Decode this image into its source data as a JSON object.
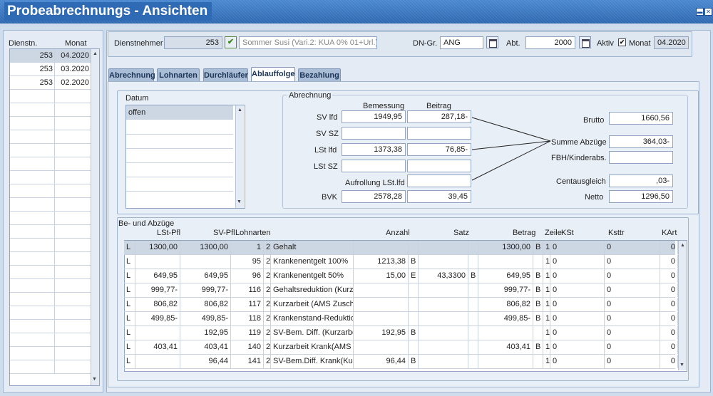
{
  "window": {
    "title": "Probeabrechnungs - Ansichten"
  },
  "left_list": {
    "headers": [
      "Dienstn.",
      "Monat"
    ],
    "rows": [
      {
        "dienstn": "253",
        "monat": "04.2020"
      },
      {
        "dienstn": "253",
        "monat": "03.2020"
      },
      {
        "dienstn": "253",
        "monat": "02.2020"
      }
    ]
  },
  "header": {
    "dienstnehmer_label": "Dienstnehmer",
    "dienstnehmer_nr": "253",
    "dienstnehmer_name": "Sommer Susi (Vari.2: KUA 0% 01+Url.)",
    "dngr_label": "DN-Gr.",
    "dngr_value": "ANG",
    "abt_label": "Abt.",
    "abt_value": "2000",
    "aktiv_label": "Aktiv",
    "aktiv_check": "✔",
    "monat_label": "Monat",
    "monat_value": "04.2020"
  },
  "tabs": [
    "Abrechnung",
    "Lohnarten",
    "Durchläufer",
    "Ablauffolge",
    "Bezahlung"
  ],
  "datum": {
    "label": "Datum",
    "items": [
      "offen"
    ]
  },
  "abrechnung": {
    "group_label": "Abrechnung",
    "col_bemessung": "Bemessung",
    "col_beitrag": "Beitrag",
    "sv_lfd_label": "SV lfd",
    "sv_lfd_bemessung": "1949,95",
    "sv_lfd_beitrag": "287,18-",
    "sv_sz_label": "SV SZ",
    "lst_lfd_label": "LSt lfd",
    "lst_lfd_bemessung": "1373,38",
    "lst_lfd_beitrag": "76,85-",
    "lst_sz_label": "LSt SZ",
    "aufrollung_label": "Aufrollung LSt.lfd",
    "bvk_label": "BVK",
    "bvk_bemessung": "2578,28",
    "bvk_beitrag": "39,45",
    "brutto_label": "Brutto",
    "brutto": "1660,56",
    "summe_label": "Summe Abzüge",
    "summe": "364,03-",
    "fbh_label": "FBH/Kinderabs.",
    "cent_label": "Centausgleich",
    "cent": ",03-",
    "netto_label": "Netto",
    "netto": "1296,50"
  },
  "grid": {
    "group_label": "Be- und Abzüge",
    "headers": {
      "lstpfl": "LSt-Pfl",
      "svpfl": "SV-Pfl",
      "lohnarten": "Lohnarten",
      "anzahl": "Anzahl",
      "satz": "Satz",
      "betrag": "Betrag",
      "zeile": "Zeile",
      "kst": "KSt",
      "ksttr": "Ksttr",
      "kart": "KArt"
    },
    "rows": [
      {
        "t": "L",
        "lst": "1300,00",
        "sv": "1300,00",
        "nr": "1",
        "k": "2",
        "name": "Gehalt",
        "anz": "",
        "af": "",
        "satz": "",
        "sf": "",
        "betrag": "1300,00",
        "bf": "B",
        "zeile": "1",
        "kst": "0",
        "ksttr": "0",
        "kart": "0"
      },
      {
        "t": "L",
        "lst": "",
        "sv": "",
        "nr": "95",
        "k": "2",
        "name": "Krankenentgelt 100%",
        "anz": "1213,38",
        "af": "B",
        "satz": "",
        "sf": "",
        "betrag": "",
        "bf": "",
        "zeile": "1",
        "kst": "0",
        "ksttr": "0",
        "kart": "0"
      },
      {
        "t": "L",
        "lst": "649,95",
        "sv": "649,95",
        "nr": "96",
        "k": "2",
        "name": "Krankenentgelt 50%",
        "anz": "15,00",
        "af": "E",
        "satz": "43,3300",
        "sf": "B",
        "betrag": "649,95",
        "bf": "B",
        "zeile": "1",
        "kst": "0",
        "ksttr": "0",
        "kart": "0"
      },
      {
        "t": "L",
        "lst": "999,77-",
        "sv": "999,77-",
        "nr": "116",
        "k": "2",
        "name": "Gehaltsreduktion (Kurz",
        "anz": "",
        "af": "",
        "satz": "",
        "sf": "",
        "betrag": "999,77-",
        "bf": "B",
        "zeile": "1",
        "kst": "0",
        "ksttr": "0",
        "kart": "0"
      },
      {
        "t": "L",
        "lst": "806,82",
        "sv": "806,82",
        "nr": "117",
        "k": "2",
        "name": "Kurzarbeit (AMS Zusch",
        "anz": "",
        "af": "",
        "satz": "",
        "sf": "",
        "betrag": "806,82",
        "bf": "B",
        "zeile": "1",
        "kst": "0",
        "ksttr": "0",
        "kart": "0"
      },
      {
        "t": "L",
        "lst": "499,85-",
        "sv": "499,85-",
        "nr": "118",
        "k": "2",
        "name": "Krankenstand-Reduktio",
        "anz": "",
        "af": "",
        "satz": "",
        "sf": "",
        "betrag": "499,85-",
        "bf": "B",
        "zeile": "1",
        "kst": "0",
        "ksttr": "0",
        "kart": "0"
      },
      {
        "t": "L",
        "lst": "",
        "sv": "192,95",
        "nr": "119",
        "k": "2",
        "name": "SV-Bem. Diff. (Kurzarbe",
        "anz": "192,95",
        "af": "B",
        "satz": "",
        "sf": "",
        "betrag": "",
        "bf": "",
        "zeile": "1",
        "kst": "0",
        "ksttr": "0",
        "kart": "0"
      },
      {
        "t": "L",
        "lst": "403,41",
        "sv": "403,41",
        "nr": "140",
        "k": "2",
        "name": "Kurzarbeit Krank(AMS Z",
        "anz": "",
        "af": "",
        "satz": "",
        "sf": "",
        "betrag": "403,41",
        "bf": "B",
        "zeile": "1",
        "kst": "0",
        "ksttr": "0",
        "kart": "0"
      },
      {
        "t": "L",
        "lst": "",
        "sv": "96,44",
        "nr": "141",
        "k": "2",
        "name": "SV-Bem.Diff. Krank(Kur",
        "anz": "96,44",
        "af": "B",
        "satz": "",
        "sf": "",
        "betrag": "",
        "bf": "",
        "zeile": "1",
        "kst": "0",
        "ksttr": "0",
        "kart": "0"
      }
    ]
  }
}
